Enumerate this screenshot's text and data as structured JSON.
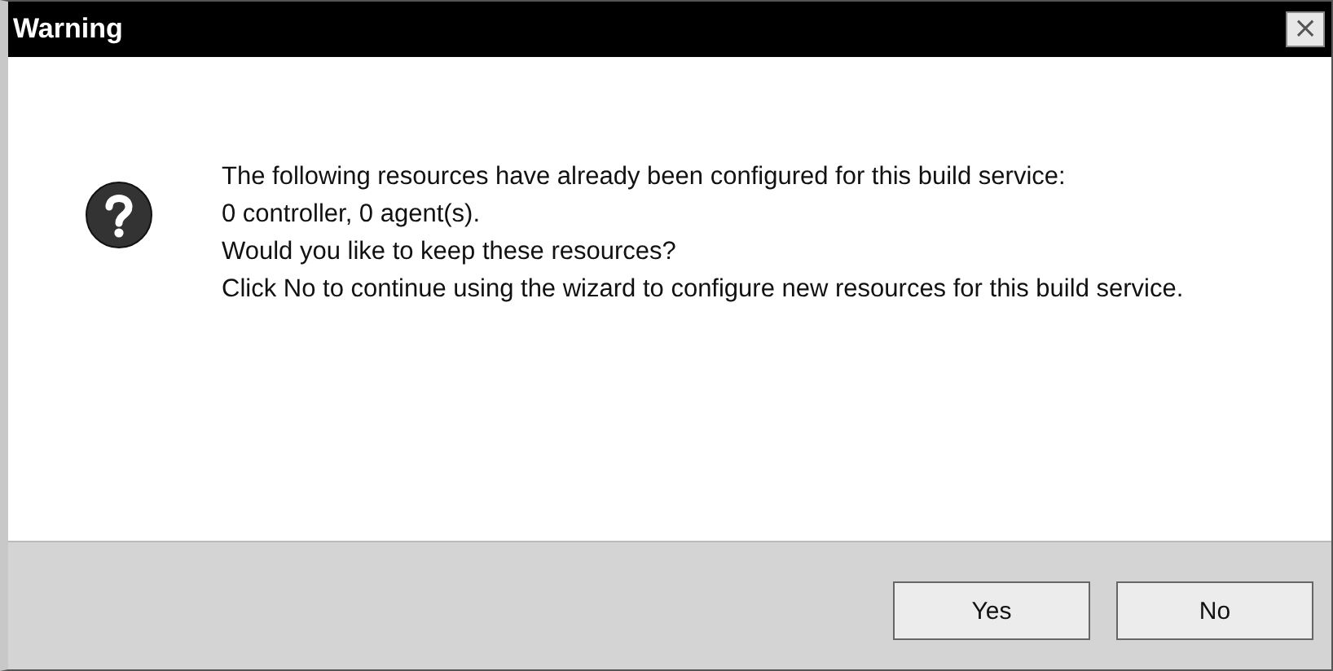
{
  "window": {
    "title": "Warning",
    "close": "×"
  },
  "message": [
    "The following resources have already been configured for this build service:",
    "0 controller, 0 agent(s).",
    "Would you like to keep these resources?",
    "Click No to continue using the wizard to configure new resources for this build service."
  ],
  "buttons": [
    {
      "label": "Yes",
      "default": false
    },
    {
      "label": "No",
      "default": false
    }
  ]
}
